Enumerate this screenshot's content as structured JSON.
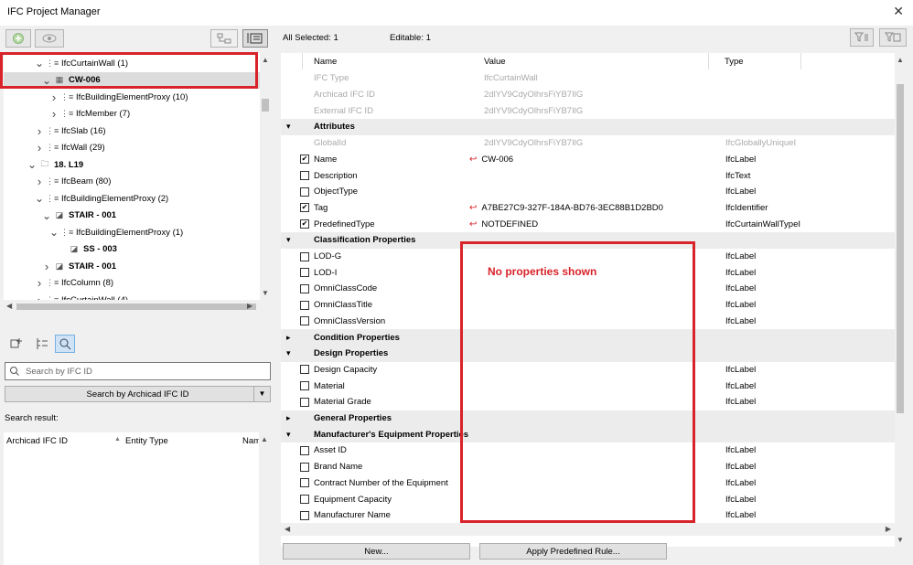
{
  "window": {
    "title": "IFC Project Manager",
    "close_glyph": "✕"
  },
  "tree": {
    "rows": [
      {
        "label": "IfcCurtainWall (1)",
        "chev": "v",
        "indent": 1,
        "icon": "entity"
      },
      {
        "label": "CW-006",
        "chev": "v",
        "indent": 2,
        "icon": "curtainwall",
        "bold": true,
        "selected": true
      },
      {
        "label": "IfcBuildingElementProxy (10)",
        "chev": ">",
        "indent": 3,
        "icon": "entity"
      },
      {
        "label": "IfcMember (7)",
        "chev": ">",
        "indent": 3,
        "icon": "entity"
      },
      {
        "label": "IfcSlab (16)",
        "chev": ">",
        "indent": 1,
        "icon": "entity"
      },
      {
        "label": "IfcWall (29)",
        "chev": ">",
        "indent": 1,
        "icon": "entity"
      },
      {
        "label": "18. L19",
        "chev": "v",
        "indent": 0,
        "icon": "storey",
        "bold": true
      },
      {
        "label": "IfcBeam (80)",
        "chev": ">",
        "indent": 1,
        "icon": "entity"
      },
      {
        "label": "IfcBuildingElementProxy (2)",
        "chev": "v",
        "indent": 1,
        "icon": "entity"
      },
      {
        "label": "STAIR - 001",
        "chev": "v",
        "indent": 2,
        "icon": "stair",
        "bold": true
      },
      {
        "label": "IfcBuildingElementProxy (1)",
        "chev": "v",
        "indent": 3,
        "icon": "entity"
      },
      {
        "label": "SS - 003",
        "chev": "",
        "indent": 4,
        "icon": "stair",
        "bold": true
      },
      {
        "label": "STAIR - 001",
        "chev": ">",
        "indent": 2,
        "icon": "stair",
        "bold": true
      },
      {
        "label": "IfcColumn (8)",
        "chev": ">",
        "indent": 1,
        "icon": "entity"
      },
      {
        "label": "IfcCurtainWall (4)",
        "chev": ">",
        "indent": 1,
        "icon": "entity"
      }
    ]
  },
  "search": {
    "placeholder": "Search by IFC ID",
    "mode_label": "Search by Archicad IFC ID",
    "result_label": "Search result:",
    "columns": [
      "Archicad IFC ID",
      "Entity Type",
      "Nam"
    ]
  },
  "header": {
    "all_selected": "All Selected: 1",
    "editable": "Editable: 1"
  },
  "grid": {
    "columns": [
      "Name",
      "Value",
      "Type"
    ],
    "rows": [
      {
        "kind": "info",
        "name": "IFC Type",
        "value": "IfcCurtainWall",
        "type": ""
      },
      {
        "kind": "info",
        "name": "Archicad IFC ID",
        "value": "2dlYV9CdyOlhrsFiYB7IlG",
        "type": ""
      },
      {
        "kind": "info",
        "name": "External IFC ID",
        "value": "2dlYV9CdyOlhrsFiYB7IlG",
        "type": ""
      },
      {
        "kind": "section",
        "name": "Attributes",
        "exp": "▾"
      },
      {
        "kind": "info",
        "name": "GlobalId",
        "value": "2dlYV9CdyOlhrsFiYB7IlG",
        "type": "IfcGloballyUniqueI"
      },
      {
        "kind": "prop",
        "checked": true,
        "revert": true,
        "name": "Name",
        "value": "CW-006",
        "type": "IfcLabel"
      },
      {
        "kind": "prop",
        "checked": false,
        "name": "Description",
        "value": "",
        "type": "IfcText"
      },
      {
        "kind": "prop",
        "checked": false,
        "name": "ObjectType",
        "value": "",
        "type": "IfcLabel"
      },
      {
        "kind": "prop",
        "checked": true,
        "revert": true,
        "name": "Tag",
        "value": "A7BE27C9-327F-184A-BD76-3EC88B1D2BD0",
        "type": "IfcIdentifier"
      },
      {
        "kind": "prop",
        "checked": true,
        "revert": true,
        "name": "PredefinedType",
        "value": "NOTDEFINED",
        "type": "IfcCurtainWallTypeI"
      },
      {
        "kind": "section",
        "name": "Classification Properties",
        "exp": "▾"
      },
      {
        "kind": "prop",
        "checked": false,
        "name": "LOD-G",
        "value": "",
        "type": "IfcLabel"
      },
      {
        "kind": "prop",
        "checked": false,
        "name": "LOD-I",
        "value": "",
        "type": "IfcLabel"
      },
      {
        "kind": "prop",
        "checked": false,
        "name": "OmniClassCode",
        "value": "",
        "type": "IfcLabel"
      },
      {
        "kind": "prop",
        "checked": false,
        "name": "OmniClassTitle",
        "value": "",
        "type": "IfcLabel"
      },
      {
        "kind": "prop",
        "checked": false,
        "name": "OmniClassVersion",
        "value": "",
        "type": "IfcLabel"
      },
      {
        "kind": "section",
        "name": "Condition Properties",
        "exp": "▸"
      },
      {
        "kind": "section",
        "name": "Design Properties",
        "exp": "▾"
      },
      {
        "kind": "prop",
        "checked": false,
        "name": "Design Capacity",
        "value": "",
        "type": "IfcLabel"
      },
      {
        "kind": "prop",
        "checked": false,
        "name": "Material",
        "value": "",
        "type": "IfcLabel"
      },
      {
        "kind": "prop",
        "checked": false,
        "name": "Material Grade",
        "value": "",
        "type": "IfcLabel"
      },
      {
        "kind": "section",
        "name": "General Properties",
        "exp": "▸"
      },
      {
        "kind": "section",
        "name": "Manufacturer's Equipment Properties",
        "exp": "▾"
      },
      {
        "kind": "prop",
        "checked": false,
        "name": "Asset ID",
        "value": "",
        "type": "IfcLabel"
      },
      {
        "kind": "prop",
        "checked": false,
        "name": "Brand Name",
        "value": "",
        "type": "IfcLabel"
      },
      {
        "kind": "prop",
        "checked": false,
        "name": "Contract Number of the Equipment",
        "value": "",
        "type": "IfcLabel"
      },
      {
        "kind": "prop",
        "checked": false,
        "name": "Equipment Capacity",
        "value": "",
        "type": "IfcLabel"
      },
      {
        "kind": "prop",
        "checked": false,
        "name": "Manufacturer Name",
        "value": "",
        "type": "IfcLabel"
      }
    ]
  },
  "annotation": {
    "text": "No properties shown",
    "color": "#d8232a"
  },
  "buttons": {
    "new": "New...",
    "apply": "Apply Predefined Rule..."
  }
}
